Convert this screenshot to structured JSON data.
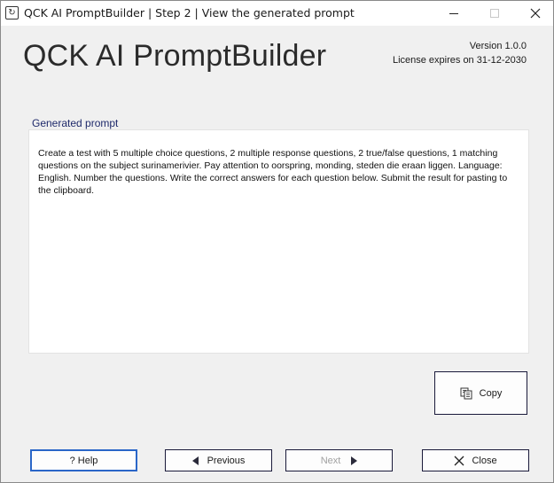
{
  "window": {
    "title": "QCK AI PromptBuilder | Step 2 | View the generated prompt"
  },
  "header": {
    "app_title": "QCK AI PromptBuilder",
    "version": "Version 1.0.0",
    "license": "License expires on 31-12-2030"
  },
  "prompt": {
    "label": "Generated prompt",
    "text": "Create a test with 5 multiple choice questions, 2 multiple response questions, 2 true/false questions, 1 matching questions on the subject surinamerivier. Pay attention to oorspring, monding, steden die eraan liggen. Language: English. Number the questions. Write the correct answers for each question below. Submit the result for pasting to the clipboard."
  },
  "buttons": {
    "copy": "Copy",
    "help": "? Help",
    "previous": "Previous",
    "next": "Next",
    "close": "Close"
  },
  "states": {
    "next_enabled": false
  },
  "colors": {
    "background": "#f0f0f0",
    "label_blue": "#1f2a6b",
    "focus_border": "#2a66c8",
    "disabled_text": "#a0a0a0"
  },
  "icons": {
    "app": "app-refresh-icon",
    "copy": "copy-icon",
    "previous": "triangle-left-icon",
    "next": "triangle-right-icon",
    "close": "close-x-icon"
  }
}
